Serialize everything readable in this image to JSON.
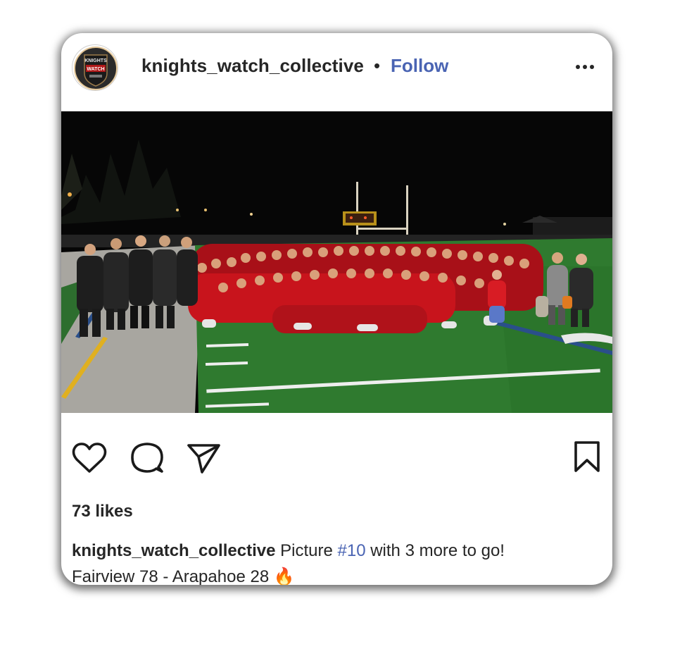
{
  "post": {
    "username": "knights_watch_collective",
    "separator": "•",
    "follow_label": "Follow",
    "avatar_text_top": "KNIGHTS",
    "avatar_text_bottom": "WATCH",
    "photo_icon": "team-photo",
    "likes": "73 likes",
    "caption": {
      "user": "knights_watch_collective",
      "text_before": "Picture",
      "hashtag": "#10",
      "text_after": "with 3 more to go!",
      "line2": "Fairview 78 - Arapahoe 28",
      "emoji": "🔥"
    }
  },
  "icons": {
    "like": "heart-icon",
    "comment": "comment-icon",
    "share": "send-icon",
    "save": "bookmark-icon",
    "more": "more-options-icon"
  },
  "colors": {
    "link": "#4a64b3",
    "text": "#262626",
    "jersey_red": "#c8141c",
    "turf": "#2f7a2f"
  }
}
